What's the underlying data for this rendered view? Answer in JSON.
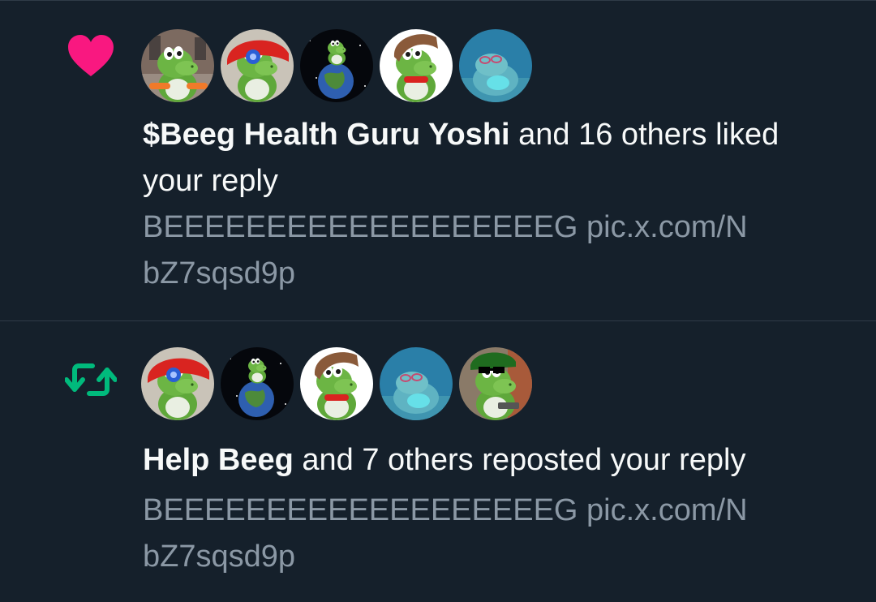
{
  "colors": {
    "background": "#15202b",
    "text": "#f7f9f9",
    "secondary_text": "#8b98a5",
    "divider": "#2f3b47",
    "like_pink": "#f91880",
    "repost_green": "#00ba7c",
    "yoshi_green": "#5fa83a"
  },
  "notifications": [
    {
      "type": "like",
      "icon": "heart-icon",
      "avatars": [
        "gym-yoshi-avatar",
        "helmet-yoshi-avatar",
        "earth-yoshi-avatar",
        "brown-hair-yoshi-avatar",
        "underwater-yoshi-avatar"
      ],
      "actor_name": "$Beeg Health Guru Yoshi",
      "action_text": " and 16 others liked your reply",
      "preview_text": "BEEEEEEEEEEEEEEEEEEEG ",
      "preview_link": "pic.x.com/NbZ7sqsd9p"
    },
    {
      "type": "repost",
      "icon": "repost-icon",
      "avatars": [
        "helmet-yoshi-avatar",
        "earth-yoshi-avatar",
        "brown-hair-yoshi-avatar",
        "underwater-yoshi-avatar",
        "sunglasses-yoshi-avatar"
      ],
      "actor_name": "Help Beeg",
      "action_text": " and 7 others reposted your reply",
      "preview_text": "BEEEEEEEEEEEEEEEEEEEG ",
      "preview_link": "pic.x.com/NbZ7sqsd9p"
    }
  ]
}
